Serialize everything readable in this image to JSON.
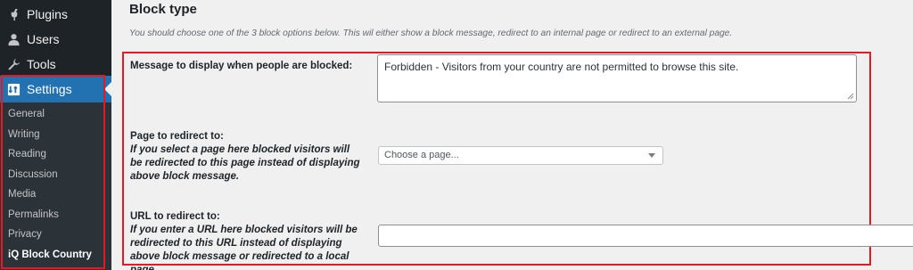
{
  "sidebar": {
    "items": [
      {
        "label": "Plugins",
        "icon": "plug-icon"
      },
      {
        "label": "Users",
        "icon": "user-icon"
      },
      {
        "label": "Tools",
        "icon": "wrench-icon"
      },
      {
        "label": "Settings",
        "icon": "settings-icon"
      }
    ],
    "submenu": [
      "General",
      "Writing",
      "Reading",
      "Discussion",
      "Media",
      "Permalinks",
      "Privacy",
      "iQ Block Country"
    ]
  },
  "main": {
    "title": "Block type",
    "description": "You should choose one of the 3 block options below. This wil either show a block message, redirect to an internal page or redirect to an external page.",
    "message_label": "Message to display when people are blocked:",
    "message_value": "Forbidden - Visitors from your country are not permitted to browse this site.",
    "page_label": "Page to redirect to:",
    "page_hint": "If you select a page here blocked visitors will be redirected to this page instead of displaying above block message.",
    "page_select_value": "Choose a page...",
    "url_label": "URL to redirect to:",
    "url_hint": "If you enter a URL here blocked visitors will be redirected to this URL instead of displaying above block message or redirected to a local page.",
    "url_value": ""
  },
  "colors": {
    "sidebar_bg": "#1d2327",
    "active_bg": "#2271b1",
    "highlight": "#e01b24"
  }
}
